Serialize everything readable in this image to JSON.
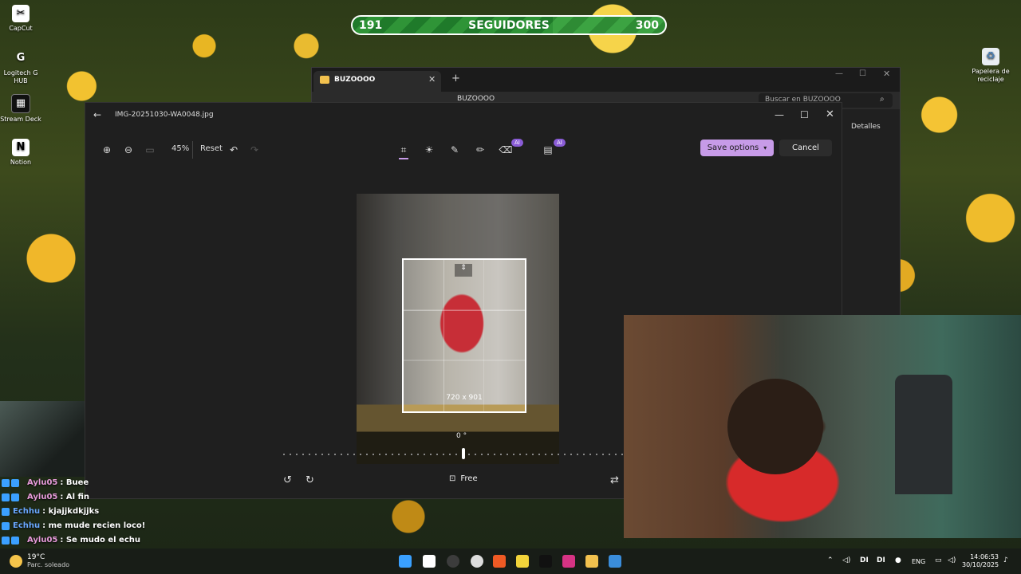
{
  "desktop_icons": [
    {
      "label": "CapCut",
      "icon": "capcut-icon",
      "color": "#ffffff"
    },
    {
      "label": "Logitech G HUB",
      "icon": "logitech-icon",
      "color": "#ffffff"
    },
    {
      "label": "Stream Deck",
      "icon": "streamdeck-icon",
      "color": "#ffffff"
    },
    {
      "label": "Notion",
      "icon": "notion-icon",
      "color": "#ffffff"
    },
    {
      "label": "Papelera de reciclaje",
      "icon": "recycle-bin-icon",
      "color": "#ffffff"
    }
  ],
  "follower_goal": {
    "current": "191",
    "label": "SEGUIDORES",
    "target": "300",
    "progress": 0.64,
    "accent": "#2e8b34"
  },
  "explorer": {
    "tab_title": "BUZOOOO",
    "path": "BUZOOOO",
    "search_placeholder": "Buscar en BUZOOOO",
    "details_label": "Detalles"
  },
  "photos": {
    "file_name": "IMG-20251030-WA0048.jpg",
    "zoom_level": "45%",
    "reset_label": "Reset",
    "ai_badge": "AI",
    "save_label": "Save options",
    "cancel_label": "Cancel",
    "crop_size": "720 x 901",
    "rotation": "0 °",
    "aspect_label": "Free",
    "accent": "#c79be8"
  },
  "chat": [
    {
      "user": "Aylu05",
      "text": ": Buee",
      "color": "#e59ad8"
    },
    {
      "user": "Aylu05",
      "text": ": Al fin",
      "color": "#e59ad8"
    },
    {
      "user": "Echhu",
      "text": ": kjajjkdkjjks",
      "color": "#6aa8ff"
    },
    {
      "user": "Echhu",
      "text": ": me mude recien loco!",
      "color": "#6aa8ff"
    },
    {
      "user": "Aylu05",
      "text": ": Se mudo el echu",
      "color": "#e59ad8"
    }
  ],
  "taskbar": {
    "weather_temp": "19°C",
    "weather_desc": "Parc. soleado",
    "lang": "ENG",
    "time": "14:06:53",
    "date": "30/10/2025",
    "tray_left": "DI",
    "tray_right": "DI"
  }
}
